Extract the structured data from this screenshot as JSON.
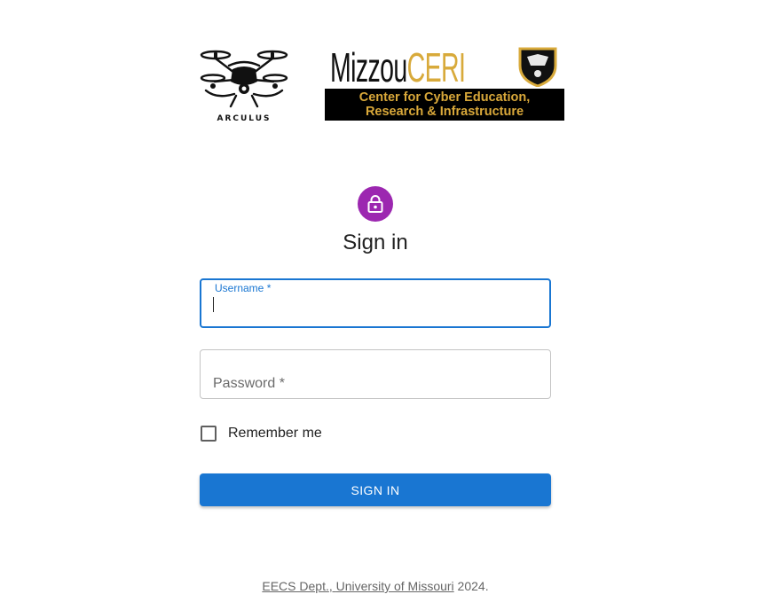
{
  "logos": {
    "drone_wordmark": "ARCULUS",
    "ceri_title_part1": "Mizzou",
    "ceri_title_part2": "CERI",
    "ceri_banner_line1": "Center for Cyber Education,",
    "ceri_banner_line2": "Research & Infrastructure",
    "ceri_accent_color": "#d8aa3b"
  },
  "form": {
    "title": "Sign in",
    "lock_icon": "lock-icon",
    "avatar_color": "#9c27b0",
    "username_label": "Username *",
    "username_value": "",
    "password_label": "Password *",
    "password_value": "",
    "remember_label": "Remember me",
    "remember_checked": false,
    "submit_label": "SIGN IN",
    "primary_color": "#1976d2"
  },
  "footer": {
    "dept_link": "EECS Dept.",
    "separator": ", ",
    "university_link": "University of Missouri",
    "year_text": " 2024."
  }
}
